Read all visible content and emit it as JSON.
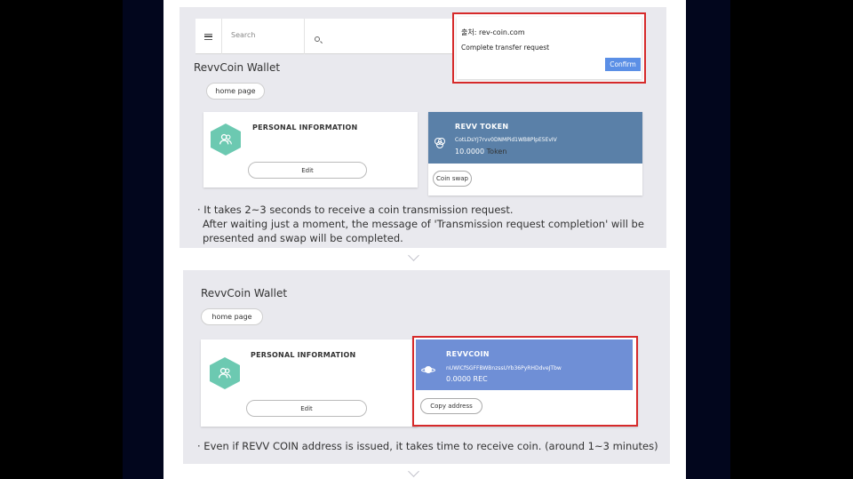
{
  "colors": {
    "panel_bg": "#e9e9ee",
    "hex_green": "#6cc9b1",
    "token_blue": "#5a80a8",
    "revvcoin_blue": "#6f8fd6",
    "highlight_red": "#d62a2a",
    "confirm_blue": "#5b8fe6"
  },
  "top_bar": {
    "menu_icon": "hamburger-icon",
    "search_placeholder": "Search",
    "search_icon": "search-icon"
  },
  "dialog": {
    "origin": "출처: rev-coin.com",
    "message": "Complete transfer request",
    "confirm_label": "Confirm"
  },
  "section1": {
    "wallet_title": "RevvCoin Wallet",
    "home_button": "home page",
    "personal_card": {
      "icon": "user-group-icon",
      "title": "PERSONAL INFORMATION",
      "edit_label": "Edit"
    },
    "token_card": {
      "icon": "overlapping-circles-icon",
      "title": "REVV TOKEN",
      "address": "CotLDsYJ7rvv0DNMPid1WB8PlpE5EvIV",
      "balance": "10.0000",
      "unit": "Token",
      "action_label": "Coin swap"
    },
    "note_line1": "· It takes 2~3 seconds to receive a coin transmission request.",
    "note_line2": "After waiting just a moment, the message of 'Transmission request completion' will be",
    "note_line3": "presented and swap will be completed."
  },
  "section2": {
    "wallet_title": "RevvCoin Wallet",
    "home_button": "home page",
    "personal_card": {
      "icon": "user-group-icon",
      "title": "PERSONAL INFORMATION",
      "edit_label": "Edit"
    },
    "coin_card": {
      "icon": "planet-icon",
      "title": "REVVCOIN",
      "address": "nUWlCfSGFFBWBnzssUYb36PyRHDdveJTbw",
      "balance": "0.0000 REC",
      "action_label": "Copy address"
    },
    "note": "· Even if REVV COIN address is issued, it takes time to receive coin. (around 1~3 minutes)"
  }
}
